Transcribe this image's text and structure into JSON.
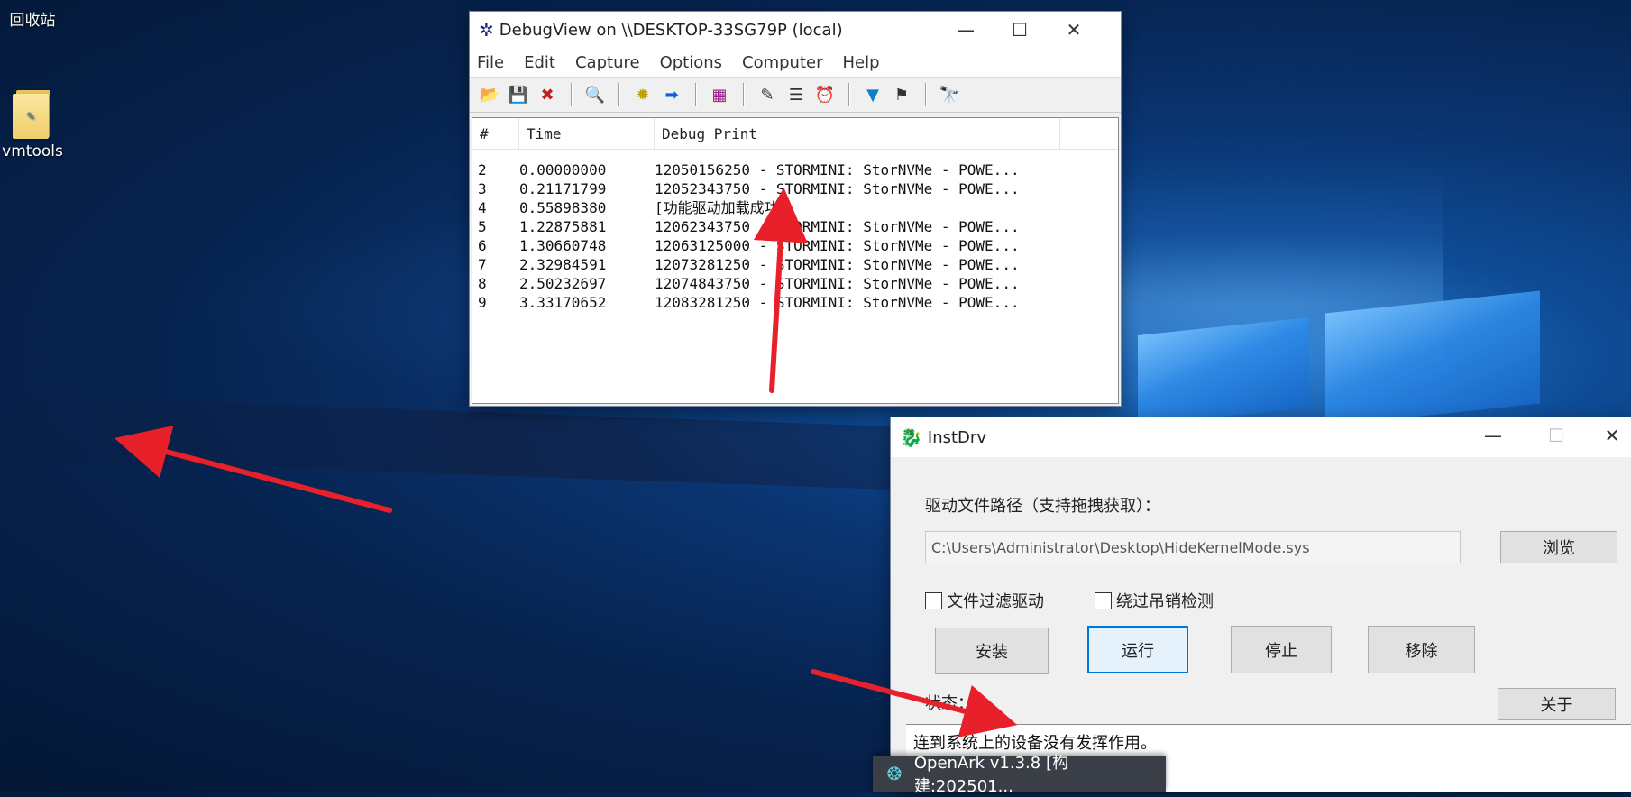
{
  "desktop": {
    "recycle_bin_label": "回收站",
    "vmtools_label": "vmtools"
  },
  "debugview": {
    "title": "DebugView on \\\\DESKTOP-33SG79P (local)",
    "menu": [
      "File",
      "Edit",
      "Capture",
      "Options",
      "Computer",
      "Help"
    ],
    "columns": [
      "#",
      "Time",
      "Debug Print"
    ],
    "rows": [
      [
        "2",
        "0.00000000",
        "12050156250 - STORMINI: StorNVMe - POWE..."
      ],
      [
        "3",
        "0.21171799",
        "12052343750 - STORMINI: StorNVMe - POWE..."
      ],
      [
        "4",
        "0.55898380",
        "[功能驱动加载成功]"
      ],
      [
        "5",
        "1.22875881",
        "12062343750 - STORMINI: StorNVMe - POWE..."
      ],
      [
        "6",
        "1.30660748",
        "12063125000 - STORMINI: StorNVMe - POWE..."
      ],
      [
        "7",
        "2.32984591",
        "12073281250 - STORMINI: StorNVMe - POWE..."
      ],
      [
        "8",
        "2.50232697",
        "12074843750 - STORMINI: StorNVMe - POWE..."
      ],
      [
        "9",
        "3.33170652",
        "12083281250 - STORMINI: StorNVMe - POWE..."
      ]
    ]
  },
  "instdrv": {
    "title": "InstDrv",
    "path_label": "驱动文件路径（支持拖拽获取）：",
    "path_value": "C:\\Users\\Administrator\\Desktop\\HideKernelMode.sys",
    "browse": "浏览",
    "file_filter": "文件过滤驱动",
    "bypass_check": "绕过吊销检测",
    "install": "安装",
    "run": "运行",
    "stop": "停止",
    "remove": "移除",
    "status_label": "状态：",
    "about": "关于",
    "status_text": "连到系统上的设备没有发挥作用。"
  },
  "taskbar_popup": {
    "label": "OpenArk v1.3.8 [构建:202501..."
  },
  "colors": {
    "accent": "#0078d7",
    "annotation_arrow": "#e8202a"
  }
}
